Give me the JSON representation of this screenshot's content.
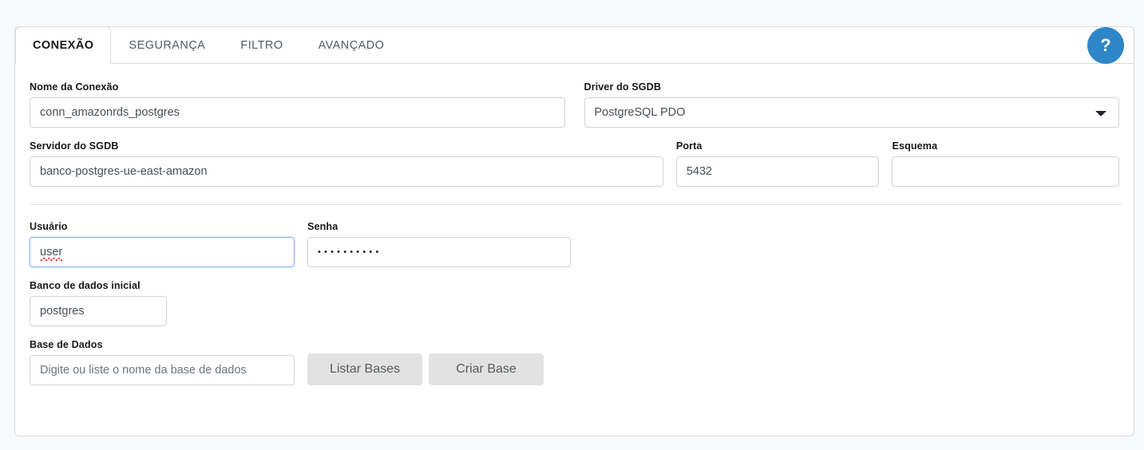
{
  "tabs": [
    {
      "label": "CONEXÃO",
      "active": true
    },
    {
      "label": "SEGURANÇA",
      "active": false
    },
    {
      "label": "FILTRO",
      "active": false
    },
    {
      "label": "AVANÇADO",
      "active": false
    }
  ],
  "help": {
    "glyph": "?",
    "color": "#2e86c8"
  },
  "form": {
    "connection_name": {
      "label": "Nome da Conexão",
      "value": "conn_amazonrds_postgres",
      "placeholder": ""
    },
    "driver": {
      "label": "Driver do SGDB",
      "value": "PostgreSQL PDO",
      "options": [
        "PostgreSQL PDO"
      ]
    },
    "server": {
      "label": "Servidor do SGDB",
      "value": "banco-postgres-ue-east-amazon",
      "placeholder": ""
    },
    "port": {
      "label": "Porta",
      "value": "5432",
      "placeholder": ""
    },
    "schema": {
      "label": "Esquema",
      "value": "",
      "placeholder": ""
    },
    "user": {
      "label": "Usuário",
      "value": "user",
      "placeholder": "",
      "focused": true,
      "spellcheck_error": true
    },
    "password": {
      "label": "Senha",
      "value": "••••••••••",
      "placeholder": ""
    },
    "initial_database": {
      "label": "Banco de dados inicial",
      "value": "postgres",
      "placeholder": ""
    },
    "database": {
      "label": "Base de Dados",
      "value": "",
      "placeholder": "Digite ou liste o nome da base de dados"
    },
    "list_bases_button": "Listar Bases",
    "create_base_button": "Criar Base"
  }
}
